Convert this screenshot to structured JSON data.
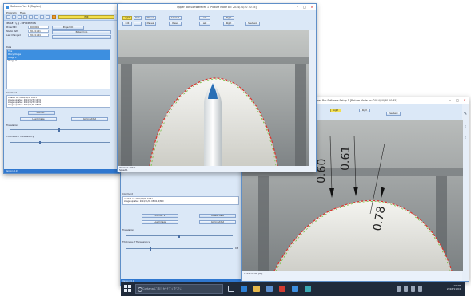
{
  "win_main": {
    "title": "SoftwareFlex 1 (Region)",
    "menu": [
      "Program",
      "Files"
    ],
    "toolbar_badge": "Edit",
    "section_image_title": "IMAGE / 写真 - INFORMATION",
    "fields": [
      {
        "label": "Project ID",
        "value": "00000001"
      },
      {
        "label": "Studio Path",
        "value": "2014/11/01"
      },
      {
        "label": "Last Changed",
        "value": "2016/11/04"
      }
    ],
    "field_side": "Project ID",
    "field_side2": "Patient Info",
    "list_title": "Data",
    "list_items": [
      "Tips",
      "Proxy Image",
      "Image 1",
      "Image 2"
    ],
    "selected_index": 2,
    "details_title": "Comment",
    "details_lines": [
      "created on: 2014/10/30 10:31",
      "image updated: 2014/10/30 10:31",
      "image updated: 2014/10/30 10:31",
      "image updated: 2014/11/01 05:02"
    ],
    "btn_edit": "Edit No. 1",
    "btn_load": "Load Image",
    "btn_cancel": "Go Unedited",
    "label_pos": "Translation",
    "label_trans": "Thickness of Transparency",
    "status": "Version 0.9"
  },
  "win_img_top": {
    "title": "Upper Bar Software Mk 1 [Picture Mode on: 2014/10/30 10:35]",
    "toggles_row1": [
      "Light",
      "Dark",
      "Manual",
      "Automat.",
      "Left",
      "Right"
    ],
    "toggles_row2": [
      "Edit",
      "",
      "Manual",
      "Preset",
      "Left",
      "Right",
      "Feedback"
    ],
    "status_left": "Zoomed: 100 %",
    "status_right": "Speed/1"
  },
  "win_img_bottom": {
    "title": "Lower Bar Software Setup 1 [Picture Mode on: 2014/10/30 10:35]",
    "toggles": [
      "Light",
      "Right"
    ],
    "toggle_extra": "Feedback",
    "measurements": [
      "0.60",
      "0.61",
      "0.78"
    ],
    "status_left": "X: 620 Y: 175 [00]"
  },
  "win_back": {
    "details_title": "Comment",
    "details_lines": [
      "created on: 2014/10/30 10:31",
      "image updated: 2014/11/01 05:02, 4/800"
    ],
    "btn_edit": "Edit No. 1",
    "btn_delete": "Delete Data",
    "btn_load": "Load Image",
    "btn_cancel": "Go Unedited",
    "label_pos": "Translation",
    "label_trans": "Thickness of Transparency",
    "status": "Version 0.9",
    "scroll_val": "0.3"
  },
  "taskbar": {
    "search_placeholder": "Cortana に話しかけてください",
    "time": "10:48",
    "date": "2016/11/04"
  }
}
